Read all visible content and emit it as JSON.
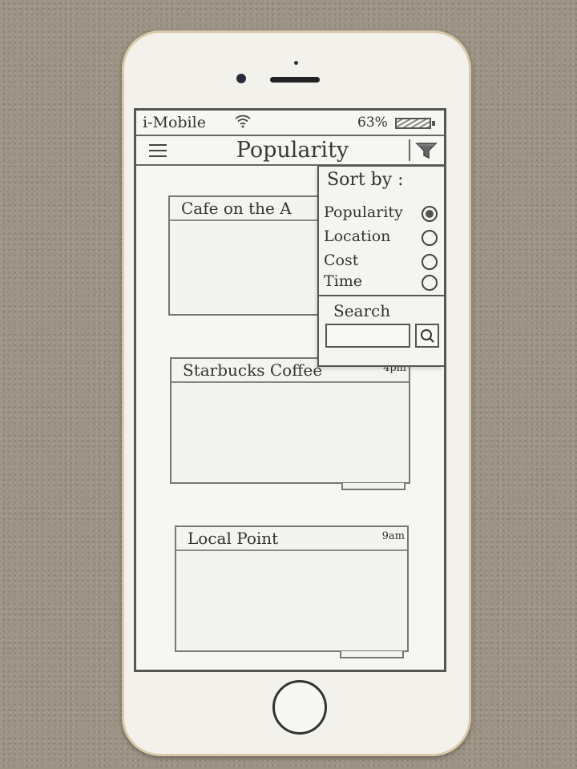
{
  "status_bar": {
    "carrier": "i-Mobile",
    "battery_percent": "63%"
  },
  "nav": {
    "title": "Popularity",
    "menu_icon": "hamburger-menu-icon",
    "filter_icon": "funnel-filter-icon"
  },
  "cards": [
    {
      "title": "Cafe on the A",
      "time": ""
    },
    {
      "title": "Starbucks Coffee",
      "time": "4pm"
    },
    {
      "title": "Local Point",
      "time": "9am"
    }
  ],
  "sort_menu": {
    "title": "Sort by :",
    "options": [
      {
        "label": "Popularity",
        "selected": true
      },
      {
        "label": "Location",
        "selected": false
      },
      {
        "label": "Cost",
        "selected": false
      },
      {
        "label": "Time",
        "selected": false
      }
    ],
    "search_label": "Search",
    "search_value": "",
    "search_placeholder": ""
  },
  "colors": {
    "background_counter": "#9c9384",
    "phone_body": "#f2f1ec",
    "phone_trim": "#d9c9a6",
    "pencil": "#333333"
  }
}
